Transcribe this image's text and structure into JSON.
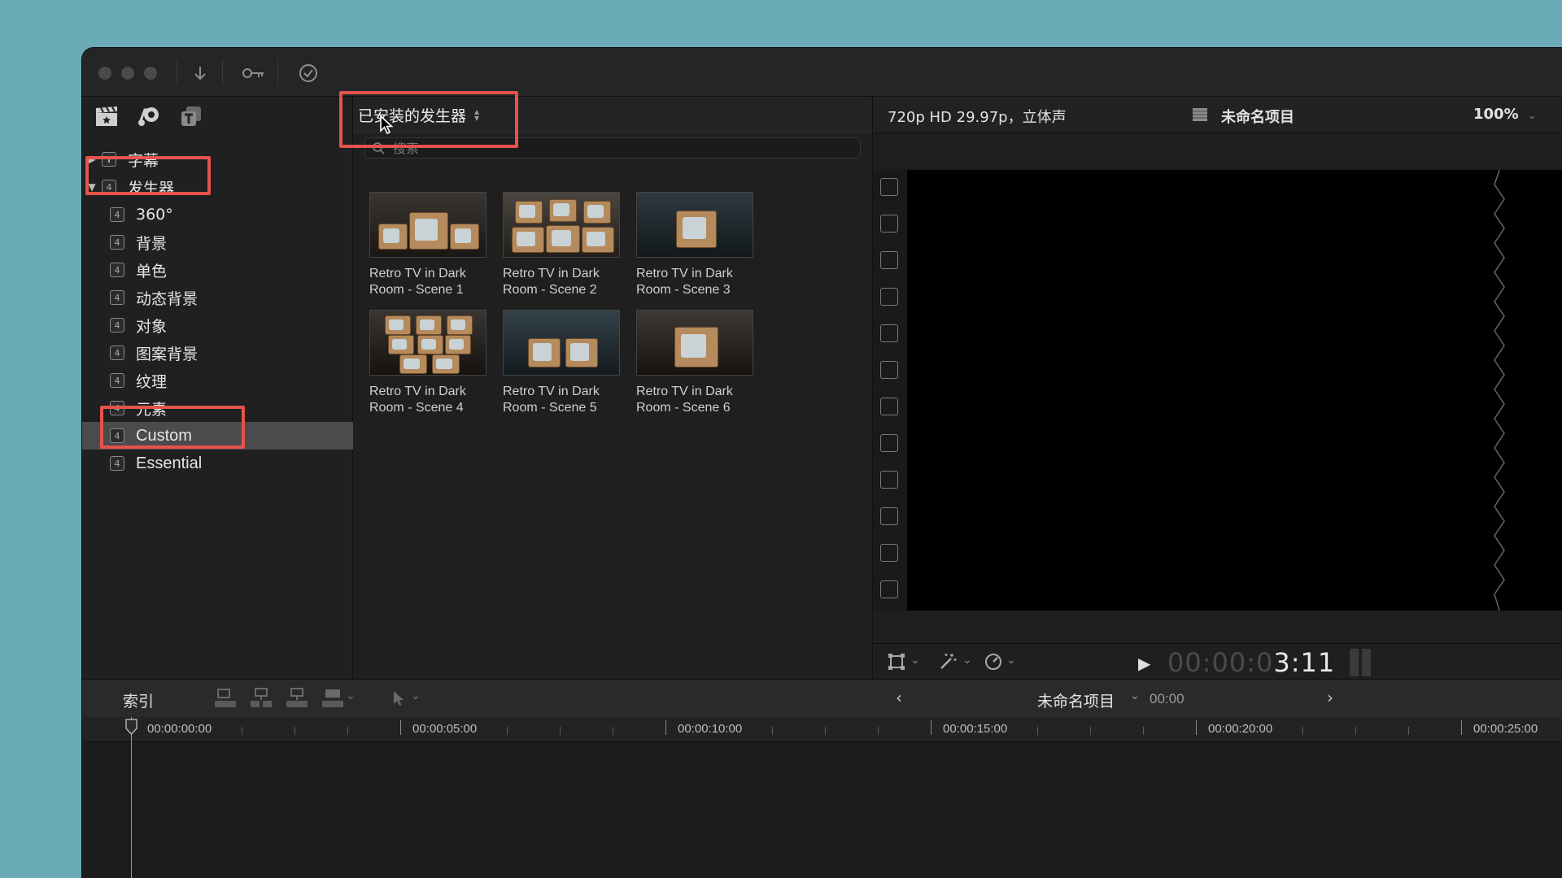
{
  "sidebar": {
    "items": [
      {
        "label": "字幕",
        "indent": 0,
        "disclosure": "▶"
      },
      {
        "label": "发生器",
        "indent": 0,
        "disclosure": "▼"
      },
      {
        "label": "360°",
        "indent": 1
      },
      {
        "label": "背景",
        "indent": 1
      },
      {
        "label": "单色",
        "indent": 1
      },
      {
        "label": "动态背景",
        "indent": 1
      },
      {
        "label": "对象",
        "indent": 1
      },
      {
        "label": "图案背景",
        "indent": 1
      },
      {
        "label": "纹理",
        "indent": 1
      },
      {
        "label": "元素",
        "indent": 1
      },
      {
        "label": "Custom",
        "indent": 1,
        "selected": true
      },
      {
        "label": "Essential",
        "indent": 1
      }
    ]
  },
  "browser": {
    "title": "已安装的发生器",
    "search_placeholder": "搜索",
    "items": [
      {
        "line1": "Retro TV in Dark",
        "line2": "Room - Scene 1"
      },
      {
        "line1": "Retro TV in Dark",
        "line2": "Room - Scene 2"
      },
      {
        "line1": "Retro TV in Dark",
        "line2": "Room - Scene 3"
      },
      {
        "line1": "Retro TV in Dark",
        "line2": "Room - Scene 4"
      },
      {
        "line1": "Retro TV in Dark",
        "line2": "Room - Scene 5"
      },
      {
        "line1": "Retro TV in Dark",
        "line2": "Room - Scene 6"
      }
    ]
  },
  "viewer": {
    "format": "720p HD 29.97p，立体声",
    "project_name": "未命名项目",
    "zoom": "100%",
    "timecode_dim": "00:00:0",
    "timecode_bright": "3:11"
  },
  "timeline": {
    "index_label": "索引",
    "project_name": "未命名项目",
    "duration": "00:00",
    "ruler_labels": [
      "00:00:00:00",
      "00:00:05:00",
      "00:00:10:00",
      "00:00:15:00",
      "00:00:20:00",
      "00:00:25:00"
    ]
  },
  "colors": {
    "highlight": "#e5534b",
    "background": "#6aaab7"
  }
}
